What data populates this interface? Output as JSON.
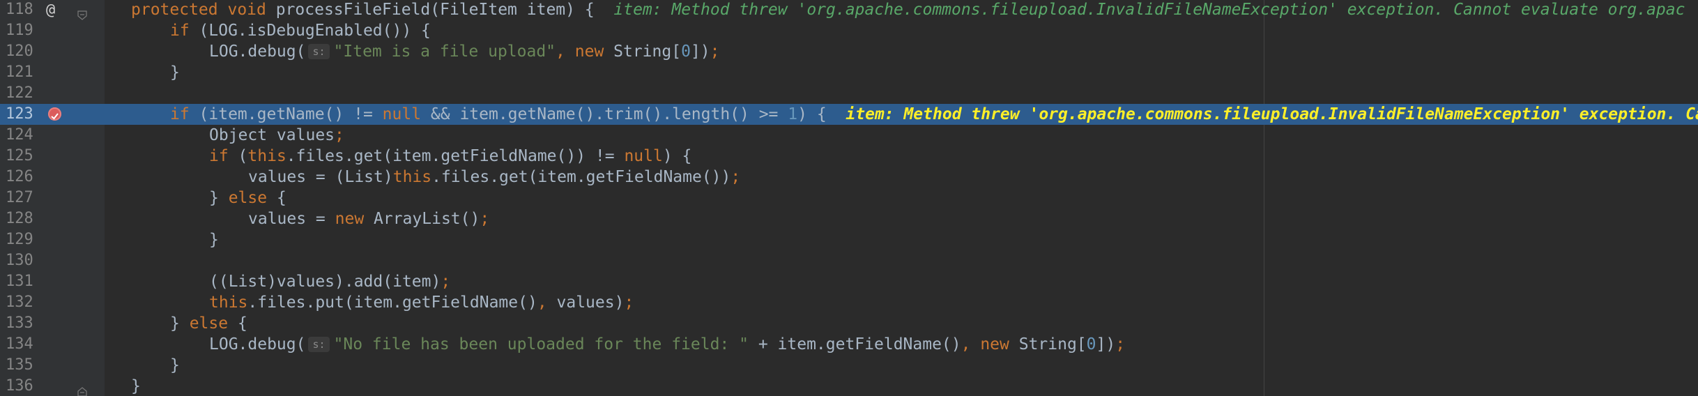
{
  "editor": {
    "gutter_marker": "@",
    "lines": [
      {
        "number": "118",
        "indent": 0,
        "tokens": [
          {
            "t": "kw",
            "v": "protected void "
          },
          {
            "t": "plain",
            "v": "processFileField(FileItem item) {  "
          },
          {
            "t": "annot",
            "v": "item: Method threw 'org.apache.commons.fileupload.InvalidFileNameException' exception. Cannot evaluate org.apac"
          }
        ]
      },
      {
        "number": "119",
        "indent": 1,
        "tokens": [
          {
            "t": "kw",
            "v": "if "
          },
          {
            "t": "plain",
            "v": "(LOG.isDebugEnabled()) {"
          }
        ]
      },
      {
        "number": "120",
        "indent": 2,
        "tokens": [
          {
            "t": "plain",
            "v": "LOG.debug("
          },
          {
            "t": "hint",
            "v": "s:"
          },
          {
            "t": "str",
            "v": "\"Item is a file upload\""
          },
          {
            "t": "op",
            "v": ", "
          },
          {
            "t": "kw",
            "v": "new "
          },
          {
            "t": "plain",
            "v": "String["
          },
          {
            "t": "num",
            "v": "0"
          },
          {
            "t": "plain",
            "v": "])"
          },
          {
            "t": "op",
            "v": ";"
          }
        ]
      },
      {
        "number": "121",
        "indent": 1,
        "tokens": [
          {
            "t": "plain",
            "v": "}"
          }
        ]
      },
      {
        "number": "122",
        "indent": 0,
        "tokens": []
      },
      {
        "number": "123",
        "indent": 1,
        "exec": true,
        "breakpoint": true,
        "tokens": [
          {
            "t": "kw",
            "v": "if "
          },
          {
            "t": "plain",
            "v": "(item.getName() != "
          },
          {
            "t": "kw",
            "v": "null "
          },
          {
            "t": "plain",
            "v": "&& item.getName().trim().length() >= "
          },
          {
            "t": "num",
            "v": "1"
          },
          {
            "t": "plain",
            "v": ") {  "
          },
          {
            "t": "annot",
            "v": "item: Method threw 'org.apache.commons.fileupload.InvalidFileNameException' exception. Cannot evaluate"
          }
        ]
      },
      {
        "number": "124",
        "indent": 2,
        "tokens": [
          {
            "t": "plain",
            "v": "Object values"
          },
          {
            "t": "op",
            "v": ";"
          }
        ]
      },
      {
        "number": "125",
        "indent": 2,
        "tokens": [
          {
            "t": "kw",
            "v": "if "
          },
          {
            "t": "plain",
            "v": "("
          },
          {
            "t": "kw",
            "v": "this"
          },
          {
            "t": "plain",
            "v": ".files.get(item.getFieldName()) != "
          },
          {
            "t": "kw",
            "v": "null"
          },
          {
            "t": "plain",
            "v": ") {"
          }
        ]
      },
      {
        "number": "126",
        "indent": 3,
        "tokens": [
          {
            "t": "plain",
            "v": "values = (List)"
          },
          {
            "t": "kw",
            "v": "this"
          },
          {
            "t": "plain",
            "v": ".files.get(item.getFieldName())"
          },
          {
            "t": "op",
            "v": ";"
          }
        ]
      },
      {
        "number": "127",
        "indent": 2,
        "tokens": [
          {
            "t": "plain",
            "v": "} "
          },
          {
            "t": "kw",
            "v": "else "
          },
          {
            "t": "plain",
            "v": "{"
          }
        ]
      },
      {
        "number": "128",
        "indent": 3,
        "tokens": [
          {
            "t": "plain",
            "v": "values = "
          },
          {
            "t": "kw",
            "v": "new "
          },
          {
            "t": "plain",
            "v": "ArrayList()"
          },
          {
            "t": "op",
            "v": ";"
          }
        ]
      },
      {
        "number": "129",
        "indent": 2,
        "tokens": [
          {
            "t": "plain",
            "v": "}"
          }
        ]
      },
      {
        "number": "130",
        "indent": 0,
        "tokens": []
      },
      {
        "number": "131",
        "indent": 2,
        "tokens": [
          {
            "t": "plain",
            "v": "((List)values).add(item)"
          },
          {
            "t": "op",
            "v": ";"
          }
        ]
      },
      {
        "number": "132",
        "indent": 2,
        "tokens": [
          {
            "t": "kw",
            "v": "this"
          },
          {
            "t": "plain",
            "v": ".files.put(item.getFieldName()"
          },
          {
            "t": "op",
            "v": ", "
          },
          {
            "t": "plain",
            "v": "values)"
          },
          {
            "t": "op",
            "v": ";"
          }
        ]
      },
      {
        "number": "133",
        "indent": 1,
        "tokens": [
          {
            "t": "plain",
            "v": "} "
          },
          {
            "t": "kw",
            "v": "else "
          },
          {
            "t": "plain",
            "v": "{"
          }
        ]
      },
      {
        "number": "134",
        "indent": 2,
        "tokens": [
          {
            "t": "plain",
            "v": "LOG.debug("
          },
          {
            "t": "hint",
            "v": "s:"
          },
          {
            "t": "str",
            "v": "\"No file has been uploaded for the field: \""
          },
          {
            "t": "plain",
            "v": " + item.getFieldName()"
          },
          {
            "t": "op",
            "v": ", "
          },
          {
            "t": "kw",
            "v": "new "
          },
          {
            "t": "plain",
            "v": "String["
          },
          {
            "t": "num",
            "v": "0"
          },
          {
            "t": "plain",
            "v": "])"
          },
          {
            "t": "op",
            "v": ";"
          }
        ]
      },
      {
        "number": "135",
        "indent": 1,
        "tokens": [
          {
            "t": "plain",
            "v": "}"
          }
        ]
      },
      {
        "number": "136",
        "indent": 0,
        "tokens": [
          {
            "t": "plain",
            "v": "}"
          }
        ]
      }
    ]
  }
}
